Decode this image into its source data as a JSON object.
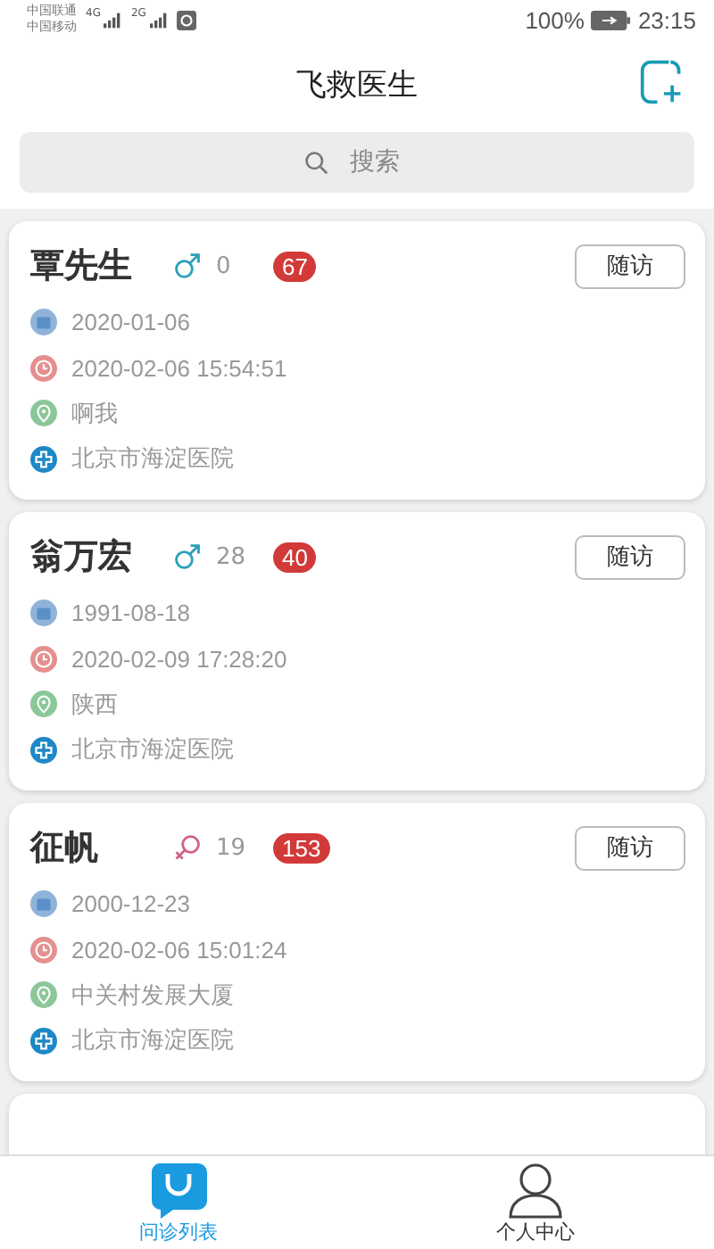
{
  "status_bar": {
    "carriers": [
      "中国联通",
      "中国移动"
    ],
    "networks": [
      "4G",
      "2G"
    ],
    "battery": "100%",
    "time": "23:15"
  },
  "header": {
    "title": "飞救医生"
  },
  "search": {
    "placeholder": "搜索"
  },
  "patients": [
    {
      "name": "覃先生",
      "kind": "male",
      "age": "0",
      "count": "67",
      "button": "随访",
      "birth": "2020-01-06",
      "time": "2020-02-06 15:54:51",
      "address": "啊我",
      "hospital": "北京市海淀医院"
    },
    {
      "name": "翁万宏",
      "kind": "male",
      "age": "28",
      "count": "40",
      "button": "随访",
      "birth": "1991-08-18",
      "time": "2020-02-09 17:28:20",
      "address": "陕西",
      "hospital": "北京市海淀医院"
    },
    {
      "name": "征帆",
      "kind": "female",
      "age": "19",
      "count": "153",
      "button": "随访",
      "birth": "2000-12-23",
      "time": "2020-02-06 15:01:24",
      "address": "中关村发展大厦",
      "hospital": "北京市海淀医院"
    }
  ],
  "tabs": [
    {
      "label": "问诊列表",
      "kind": "consult",
      "selected": true
    },
    {
      "label": "个人中心",
      "kind": "profile",
      "selected": false
    }
  ]
}
